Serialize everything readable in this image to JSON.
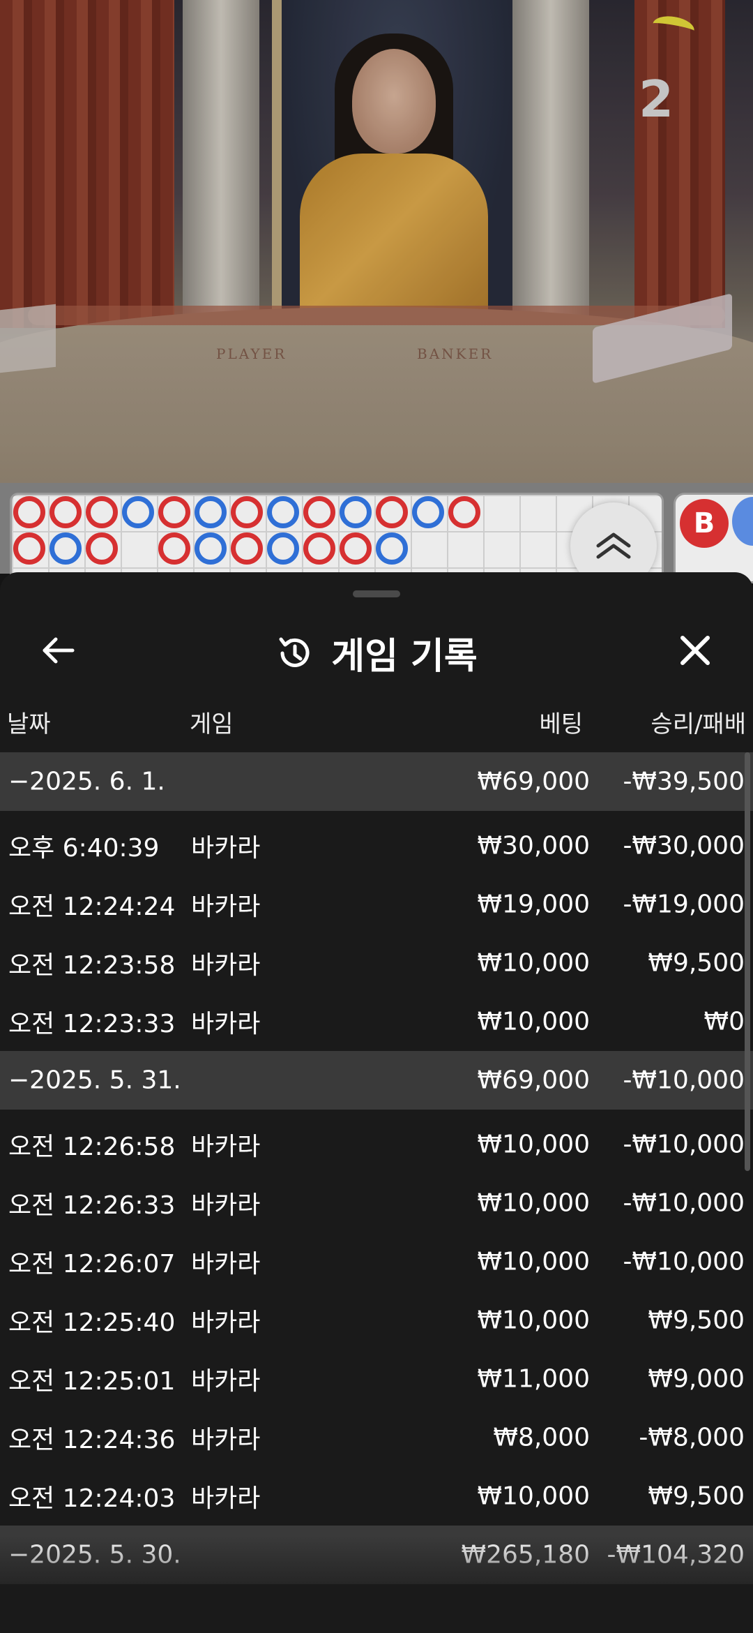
{
  "video": {
    "round_number": "2",
    "table_labels": {
      "player": "PLAYER",
      "banker": "BANKER"
    }
  },
  "roadmap": {
    "row1": [
      "r",
      "r",
      "r",
      "b",
      "r",
      "b",
      "r",
      "b",
      "r",
      "b",
      "r",
      "b",
      "r"
    ],
    "row2": [
      "r",
      "b",
      "r",
      "",
      "r",
      "b",
      "r",
      "b",
      "r",
      "r",
      "b"
    ],
    "side_chip": "B"
  },
  "sheet": {
    "title": "게임 기록",
    "columns": {
      "date": "날짜",
      "game": "게임",
      "bet": "베팅",
      "win_loss": "승리/패배"
    },
    "groups": [
      {
        "date": "−2025. 6. 1.",
        "bet": "₩69,000",
        "win_loss": "-₩39,500",
        "rows": [
          {
            "time": "오후 6:40:39",
            "game": "바카라",
            "bet": "₩30,000",
            "win_loss": "-₩30,000"
          },
          {
            "time": "오전 12:24:24",
            "game": "바카라",
            "bet": "₩19,000",
            "win_loss": "-₩19,000"
          },
          {
            "time": "오전 12:23:58",
            "game": "바카라",
            "bet": "₩10,000",
            "win_loss": "₩9,500"
          },
          {
            "time": "오전 12:23:33",
            "game": "바카라",
            "bet": "₩10,000",
            "win_loss": "₩0"
          }
        ]
      },
      {
        "date": "−2025. 5. 31.",
        "bet": "₩69,000",
        "win_loss": "-₩10,000",
        "rows": [
          {
            "time": "오전 12:26:58",
            "game": "바카라",
            "bet": "₩10,000",
            "win_loss": "-₩10,000"
          },
          {
            "time": "오전 12:26:33",
            "game": "바카라",
            "bet": "₩10,000",
            "win_loss": "-₩10,000"
          },
          {
            "time": "오전 12:26:07",
            "game": "바카라",
            "bet": "₩10,000",
            "win_loss": "-₩10,000"
          },
          {
            "time": "오전 12:25:40",
            "game": "바카라",
            "bet": "₩10,000",
            "win_loss": "₩9,500"
          },
          {
            "time": "오전 12:25:01",
            "game": "바카라",
            "bet": "₩11,000",
            "win_loss": "₩9,000"
          },
          {
            "time": "오전 12:24:36",
            "game": "바카라",
            "bet": "₩8,000",
            "win_loss": "-₩8,000"
          },
          {
            "time": "오전 12:24:03",
            "game": "바카라",
            "bet": "₩10,000",
            "win_loss": "₩9,500"
          }
        ]
      },
      {
        "date": "−2025. 5. 30.",
        "bet": "₩265,180",
        "win_loss": "-₩104,320",
        "rows": []
      }
    ]
  },
  "colors": {
    "banker_red": "#d63031",
    "player_blue": "#2f6fd6",
    "sheet_bg": "#1a1a1a",
    "group_header_bg": "#3a3a3a"
  },
  "icons": {
    "back": "arrow-left-icon",
    "history": "history-icon",
    "close": "close-icon",
    "scroll_up": "chevron-double-up-icon"
  }
}
